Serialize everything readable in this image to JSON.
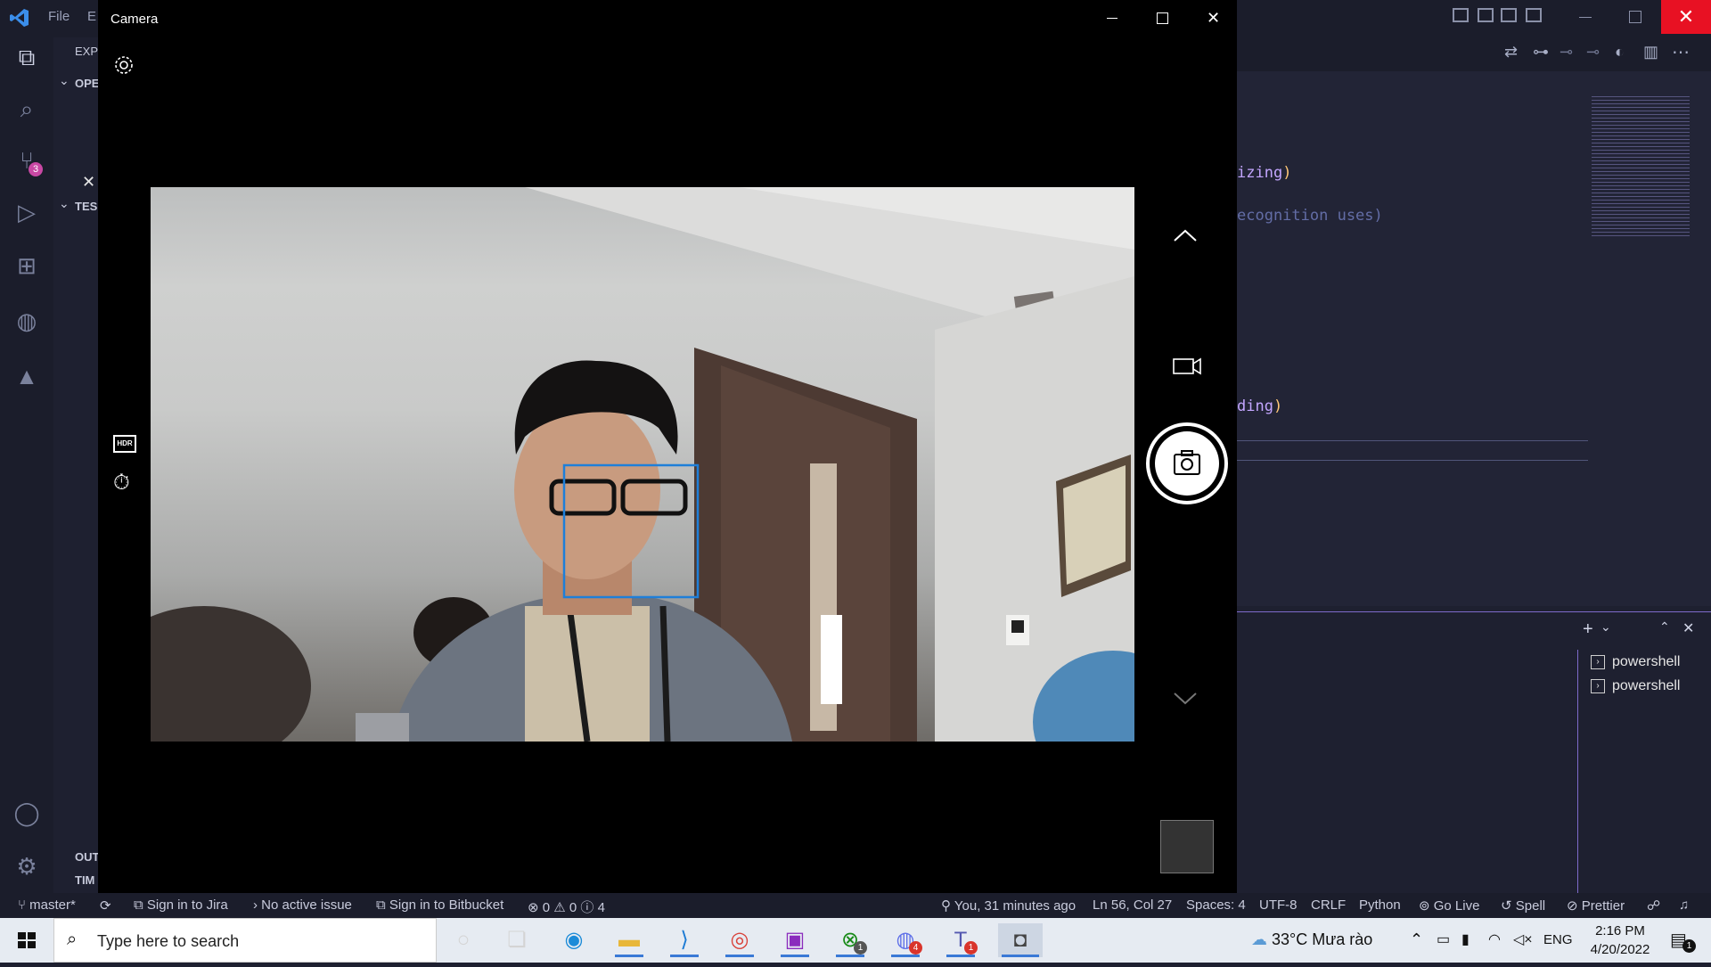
{
  "vscode": {
    "menu": {
      "file": "File",
      "edit_partial": "E"
    },
    "sidebar": {
      "explorer_label": "EXP",
      "open_editors": "OPE",
      "tests_section": "TES",
      "outline": "OUT",
      "timeline": "TIM"
    },
    "scm_badge": "3",
    "editor": {
      "code_fragments": [
        {
          "text": "izing",
          "paren": ")"
        },
        {
          "text": "ecognition uses)",
          "paren": ""
        },
        {
          "text": "ding",
          "paren": ")"
        }
      ]
    },
    "terminal": {
      "items": [
        "powershell",
        "powershell"
      ]
    },
    "status_bar": {
      "branch": "master*",
      "jira": "Sign in to Jira",
      "issue": "No active issue",
      "bitbucket": "Sign in to Bitbucket",
      "errors": "0",
      "warnings": "0",
      "infos": "4",
      "blame": "You, 31 minutes ago",
      "position": "Ln 56, Col 27",
      "spaces": "Spaces: 4",
      "encoding": "UTF-8",
      "eol": "CRLF",
      "language": "Python",
      "golive": "Go Live",
      "spell": "Spell",
      "prettier": "Prettier"
    },
    "colors": {
      "accent": "#7e6bcb",
      "background": "#1e2030"
    }
  },
  "camera_window": {
    "title": "Camera",
    "icons": [
      "settings-icon",
      "hdr-icon",
      "timer-icon",
      "chevron-up-icon",
      "video-mode-icon",
      "photo-capture-icon",
      "chevron-down-icon"
    ],
    "face_box_color": "#1e7fd9"
  },
  "taskbar": {
    "search_placeholder": "Type here to search",
    "apps": [
      "cortana",
      "task-view",
      "edge",
      "file-explorer",
      "vscode",
      "chrome",
      "app-purple",
      "xbox",
      "app-discord",
      "teams",
      "camera"
    ],
    "badges": {
      "xbox": "1",
      "app_discord": "4",
      "teams": "1"
    },
    "weather": "33°C  Mưa rào",
    "language": "ENG",
    "time": "2:16 PM",
    "date": "4/20/2022",
    "notification_count": "1"
  }
}
